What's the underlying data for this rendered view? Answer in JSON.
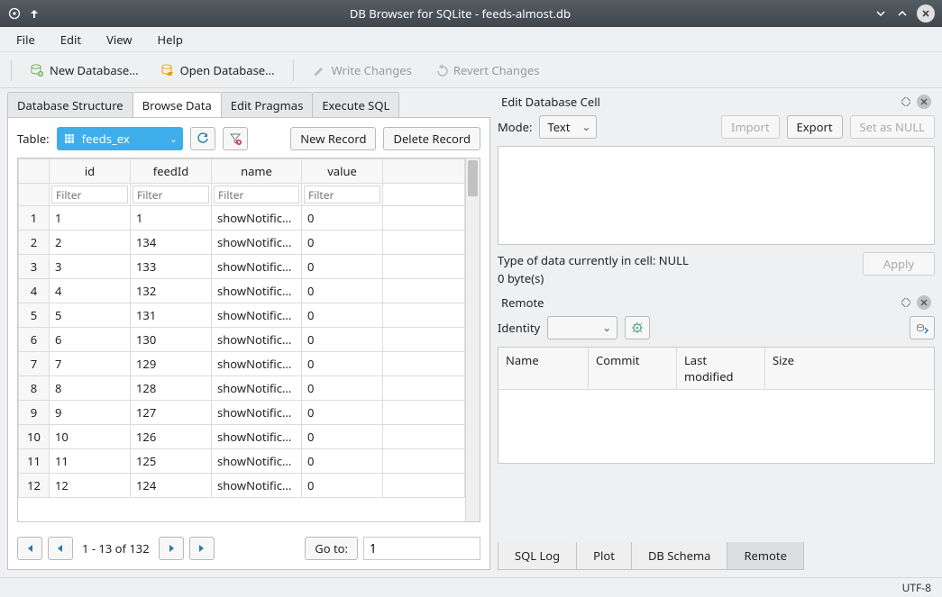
{
  "window": {
    "title": "DB Browser for SQLite - feeds-almost.db"
  },
  "menu": {
    "file": "File",
    "edit": "Edit",
    "view": "View",
    "help": "Help"
  },
  "toolbar": {
    "new_db": "New Database...",
    "open_db": "Open Database...",
    "write": "Write Changes",
    "revert": "Revert Changes"
  },
  "left_tabs": {
    "structure": "Database Structure",
    "browse": "Browse Data",
    "pragmas": "Edit Pragmas",
    "sql": "Execute SQL"
  },
  "browse": {
    "table_label": "Table:",
    "table_selected": "feeds_ex",
    "new_record": "New Record",
    "delete_record": "Delete Record",
    "columns": {
      "id": "id",
      "feedId": "feedId",
      "name": "name",
      "value": "value"
    },
    "filter_placeholder": "Filter",
    "rows": [
      {
        "n": "1",
        "id": "1",
        "feedId": "1",
        "name": "showNotific...",
        "value": "0"
      },
      {
        "n": "2",
        "id": "2",
        "feedId": "134",
        "name": "showNotific...",
        "value": "0"
      },
      {
        "n": "3",
        "id": "3",
        "feedId": "133",
        "name": "showNotific...",
        "value": "0"
      },
      {
        "n": "4",
        "id": "4",
        "feedId": "132",
        "name": "showNotific...",
        "value": "0"
      },
      {
        "n": "5",
        "id": "5",
        "feedId": "131",
        "name": "showNotific...",
        "value": "0"
      },
      {
        "n": "6",
        "id": "6",
        "feedId": "130",
        "name": "showNotific...",
        "value": "0"
      },
      {
        "n": "7",
        "id": "7",
        "feedId": "129",
        "name": "showNotific...",
        "value": "0"
      },
      {
        "n": "8",
        "id": "8",
        "feedId": "128",
        "name": "showNotific...",
        "value": "0"
      },
      {
        "n": "9",
        "id": "9",
        "feedId": "127",
        "name": "showNotific...",
        "value": "0"
      },
      {
        "n": "10",
        "id": "10",
        "feedId": "126",
        "name": "showNotific...",
        "value": "0"
      },
      {
        "n": "11",
        "id": "11",
        "feedId": "125",
        "name": "showNotific...",
        "value": "0"
      },
      {
        "n": "12",
        "id": "12",
        "feedId": "124",
        "name": "showNotific...",
        "value": "0"
      }
    ],
    "pager": {
      "range": "1 - 13 of 132",
      "goto_label": "Go to:",
      "goto_value": "1"
    }
  },
  "cell_panel": {
    "title": "Edit Database Cell",
    "mode_label": "Mode:",
    "mode_value": "Text",
    "import_btn": "Import",
    "export_btn": "Export",
    "null_btn": "Set as NULL",
    "type_line": "Type of data currently in cell: NULL",
    "size_line": "0 byte(s)",
    "apply_btn": "Apply"
  },
  "remote_panel": {
    "title": "Remote",
    "identity_label": "Identity",
    "cols": {
      "name": "Name",
      "commit": "Commit",
      "last": "Last modified",
      "size": "Size"
    }
  },
  "bottom_tabs": {
    "sqllog": "SQL Log",
    "plot": "Plot",
    "schema": "DB Schema",
    "remote": "Remote"
  },
  "status": {
    "encoding": "UTF-8"
  }
}
